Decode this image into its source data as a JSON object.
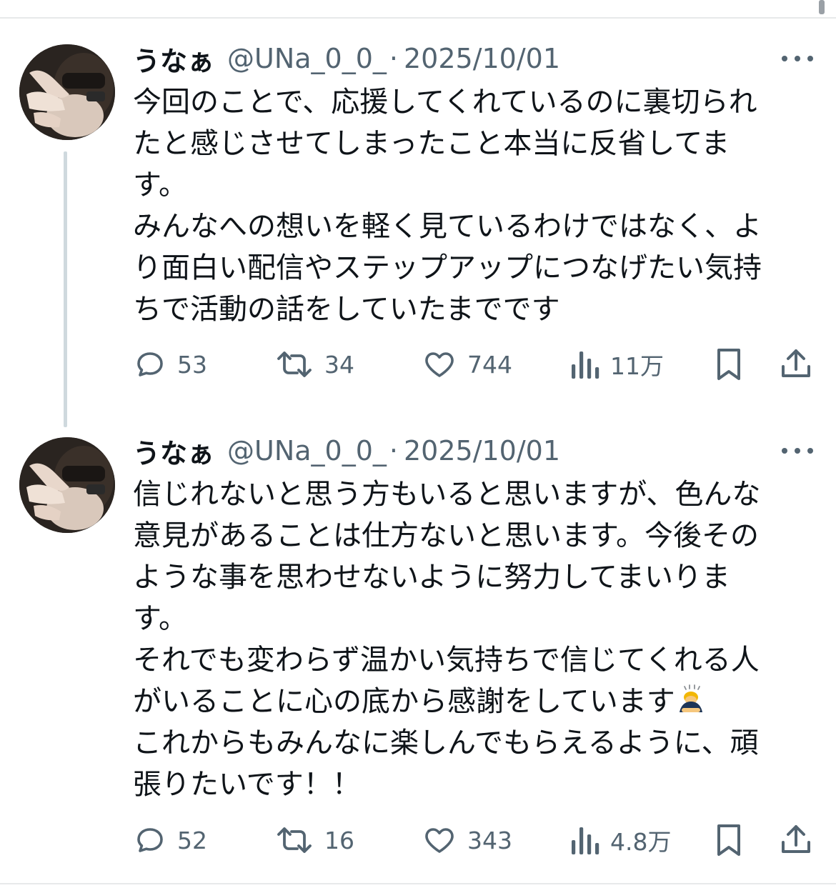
{
  "tweets": [
    {
      "name": "うなぁ",
      "handle": "@UNa_0_0_",
      "separator": "·",
      "date": "2025/10/01",
      "lines": [
        "今回のことで、応援してくれているのに裏切られ",
        "たと感じさせてしまったこと本当に反省してま",
        "す。",
        "みんなへの想いを軽く見ているわけではなく、よ",
        "り面白い配信やステップアップにつなげたい気持",
        "ちで活動の話をしていたまでです"
      ],
      "emoji": "",
      "stats": {
        "replies": "53",
        "reposts": "34",
        "likes": "744",
        "views": "11万"
      }
    },
    {
      "name": "うなぁ",
      "handle": "@UNa_0_0_",
      "separator": "·",
      "date": "2025/10/01",
      "lines": [
        "信じれないと思う方もいると思いますが、色んな",
        "意見があることは仕方ないと思います。今後その",
        "ような事を思わせないように努力してまいりま",
        "す。",
        "それでも変わらず温かい気持ちで信じてくれる人",
        "がいることに心の底から感謝をしています",
        "これからもみんなに楽しんでもらえるように、頑",
        "張りたいです！！"
      ],
      "emoji": "🙇",
      "emoji_after_line": 5,
      "stats": {
        "replies": "52",
        "reposts": "16",
        "likes": "343",
        "views": "4.8万"
      }
    }
  ],
  "icons": {
    "reply": "reply-icon",
    "repost": "repost-icon",
    "like": "like-heart-icon",
    "views": "views-bar-chart-icon",
    "bookmark": "bookmark-icon",
    "share": "share-icon",
    "more": "more-dots-icon"
  },
  "colors": {
    "text": "#0f1419",
    "secondary": "#536471",
    "thread_line": "#cfd9de",
    "divider": "#e7e9ea"
  }
}
